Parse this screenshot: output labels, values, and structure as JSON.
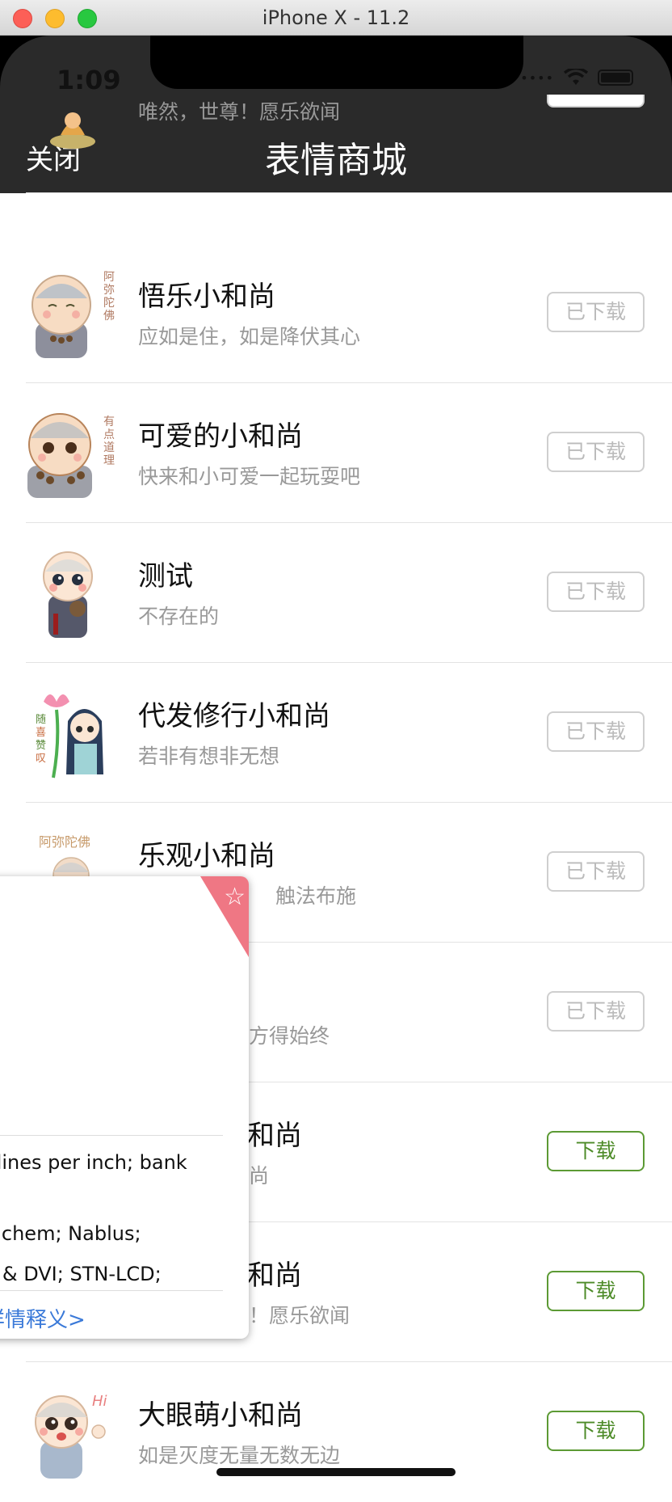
{
  "window": {
    "title": "iPhone X - 11.2"
  },
  "status": {
    "time": "1:09",
    "signal_icon": "signal-dots-icon",
    "wifi_icon": "wifi-icon",
    "battery_icon": "battery-icon"
  },
  "nav": {
    "close_label": "关闭",
    "title": "表情商城"
  },
  "list": {
    "partial_top": {
      "desc": "唯然，世尊！愿乐欲闻"
    },
    "items": [
      {
        "name": "悟乐小和尚",
        "desc": "应如是住，如是降伏其心",
        "button": "已下载"
      },
      {
        "name": "可爱的小和尚",
        "desc": "快来和小可爱一起玩耍吧",
        "button": "已下载"
      },
      {
        "name": "测试",
        "desc": "不存在的",
        "button": "已下载"
      },
      {
        "name": "代发修行小和尚",
        "desc": "若非有想非无想",
        "button": "已下载"
      },
      {
        "name": "乐观小和尚",
        "desc": "触法布施",
        "button": "已下载"
      },
      {
        "name": "",
        "desc": "方得始终",
        "button": "已下载"
      },
      {
        "name": "和尚",
        "desc": "尚",
        "button": "下载"
      },
      {
        "name": "和尚",
        "desc": "！愿乐欲闻",
        "button": "下载"
      },
      {
        "name": "大眼萌小和尚",
        "desc": "如是灭度无量无数无边",
        "button": "下载"
      }
    ]
  },
  "popup": {
    "star_icon": "star-icon",
    "line1": "; lines per inch; bank",
    "line2": "Sichem; Nablus;",
    "line3": "g & DVI; STN-LCD;",
    "link": "详情释义>"
  },
  "colors": {
    "nav_bg": "#2a2a2a",
    "download_green": "#4d8b28",
    "ribbon": "#ef7784",
    "link": "#3a79d8"
  }
}
